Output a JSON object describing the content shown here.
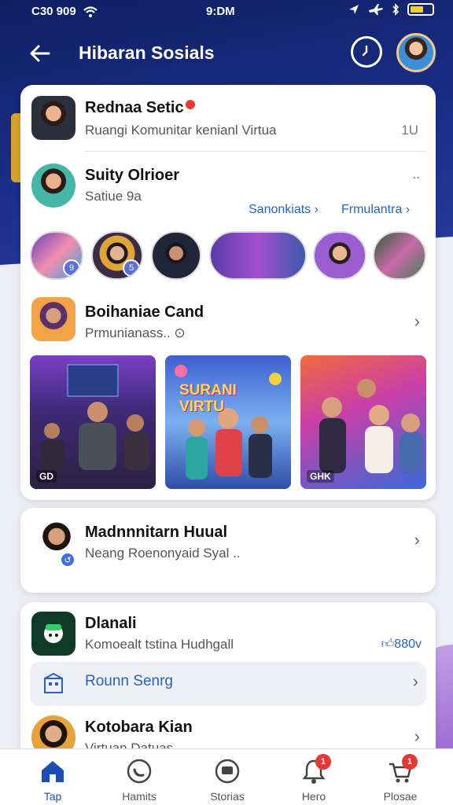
{
  "status_bar": {
    "left_text": "C30 909",
    "time": "9:DM",
    "icons": [
      "wifi-icon",
      "location-icon",
      "airplane-icon",
      "bluetooth-icon",
      "battery-icon"
    ]
  },
  "header": {
    "title": "Hibaran Sosials",
    "back_icon": "arrow-left-icon",
    "timer_icon": "timer-icon"
  },
  "card1": {
    "item1": {
      "title": "Rednaa Setic",
      "subtitle": "Ruangi Komunitar kenianl Virtua",
      "meta": "1U"
    },
    "item2": {
      "title": "Suity Olrioer",
      "subtitle": "Satiue 9a",
      "more": "..",
      "link1": "Sanonkiats",
      "link2": "Frmulantra"
    },
    "stories": [
      {
        "name": "story-1",
        "badge": "9"
      },
      {
        "name": "story-2",
        "badge": "5"
      },
      {
        "name": "story-3",
        "badge": ""
      },
      {
        "name": "story-4",
        "badge": ""
      },
      {
        "name": "story-5",
        "badge": ""
      },
      {
        "name": "story-6",
        "badge": ""
      }
    ],
    "item3": {
      "title": "Boihaniae Cand",
      "subtitle": "Prmunianass.."
    },
    "photos": [
      {
        "tag": "GD"
      },
      {
        "title_text": "SURANI VIRTU"
      },
      {
        "tag": "GHK"
      }
    ]
  },
  "card2": {
    "title": "Madnnnitarn Huual",
    "subtitle": "Neang Roenonyaid Syal .."
  },
  "card3": {
    "item1": {
      "title": "Dlanali",
      "subtitle": "Komoealt tstina Hudhgall",
      "likes": "880v"
    },
    "inner": {
      "label": "Rounn Senrg"
    },
    "item2": {
      "title": "Kotobara Kian",
      "subtitle": "Virtuan Datuas"
    }
  },
  "bottom_nav": {
    "items": [
      {
        "label": "Tap",
        "icon": "home-icon",
        "active": true,
        "badge": ""
      },
      {
        "label": "Hamits",
        "icon": "chat-icon",
        "active": false,
        "badge": ""
      },
      {
        "label": "Storias",
        "icon": "stories-icon",
        "active": false,
        "badge": ""
      },
      {
        "label": "Hero",
        "icon": "bell-icon",
        "active": false,
        "badge": "1"
      },
      {
        "label": "Plosae",
        "icon": "cart-icon",
        "active": false,
        "badge": "1"
      }
    ]
  },
  "colors": {
    "header_bg": "#1b2f8a",
    "accent": "#2663c4",
    "badge_red": "#e53935",
    "active_nav": "#1e4db7"
  }
}
